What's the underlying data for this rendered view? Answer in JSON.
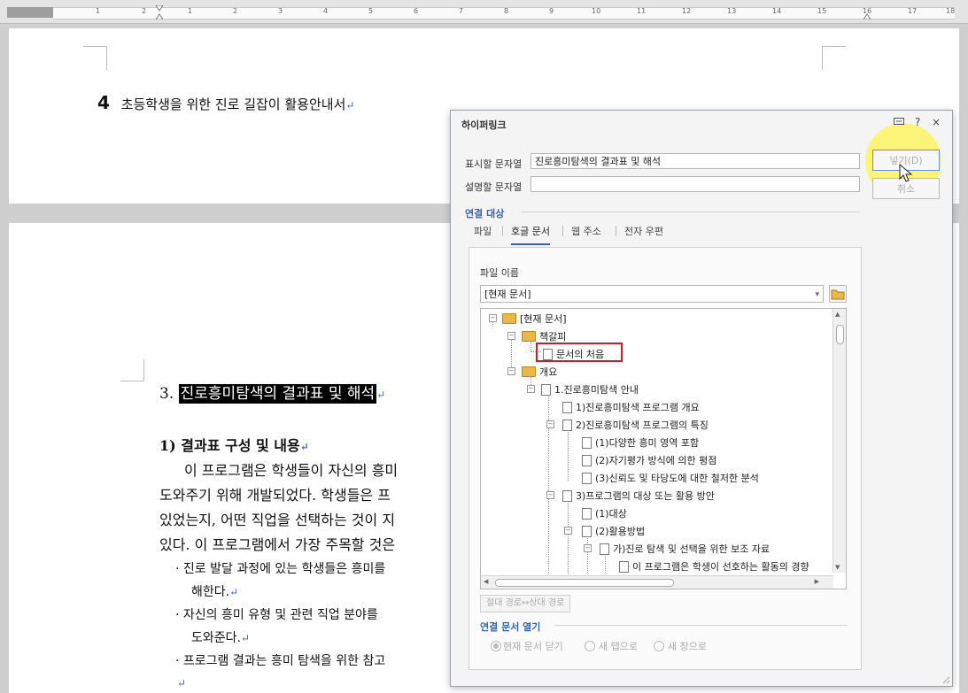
{
  "ruler": {
    "numbers": [
      "1",
      "2",
      "1",
      "2",
      "3",
      "4",
      "5",
      "6",
      "7",
      "8",
      "9",
      "10",
      "11",
      "12",
      "13",
      "14",
      "15",
      "16",
      "17",
      "18"
    ]
  },
  "document": {
    "page1_heading_num": "4",
    "page1_heading": "초등학생을 위한 진로 길잡이 활용안내서",
    "section_num": "3.",
    "section_title": "진로흥미탐색의 결과표 및 해석",
    "sub_heading": "1) 결과표 구성 및 내용",
    "body_lines": [
      "이 프로그램은 학생들이 자신의 흥미",
      "도와주기 위해 개발되었다. 학생들은 프",
      "있었는지, 어떤 직업을 선택하는 것이 지",
      "있다. 이 프로그램에서 가장 주목할 것은"
    ],
    "bullets": [
      "· 진로 발달 과정에 있는 학생들은 흥미를",
      "해한다.",
      "· 자신의 흥미 유형 및 관련 직업 분야를",
      "도와준다.",
      "· 프로그램 결과는 흥미 탐색을 위한 참고"
    ],
    "para_mark": "↵"
  },
  "dialog": {
    "title": "하이퍼링크",
    "help": "?",
    "close": "×",
    "display_label": "표시할 문자열",
    "display_value": "진로흥미탐색의 결과표 및 해석",
    "desc_label": "설명할 문자열",
    "desc_value": "",
    "insert_btn": "넣기(D)",
    "cancel_btn": "취소",
    "link_target_label": "연결 대상",
    "tabs": [
      "파일",
      "호글 문서",
      "웹 주소",
      "전자 우편"
    ],
    "file_name_label": "파일 이름",
    "file_select": "[현재 문서]",
    "tree": [
      "[현재 문서]",
      "책갈피",
      "문서의 처음",
      "개요",
      "1.진로흥미탐색 안내",
      "1)진로흥미탐색 프로그램 개요",
      "2)진로흥미탐색 프로그램의 특징",
      "(1)다양한 흥미 영역 포함",
      "(2)자기평가 방식에 의한 평점",
      "(3)신뢰도 및 타당도에 대한 철저한 분석",
      "3)프로그램의 대상 또는 활용 방안",
      "(1)대상",
      "(2)활용방법",
      "가)진로 탐색 및 선택을 위한 보조 자료",
      "이 프로그램은 학생이 선호하는 활동의 경향"
    ],
    "path_toggle": "절대 경로↔상대 경로",
    "open_label": "연결 문서 열기",
    "radios": [
      "현재 문서 닫기",
      "새 탭으로",
      "새 창으로"
    ]
  }
}
